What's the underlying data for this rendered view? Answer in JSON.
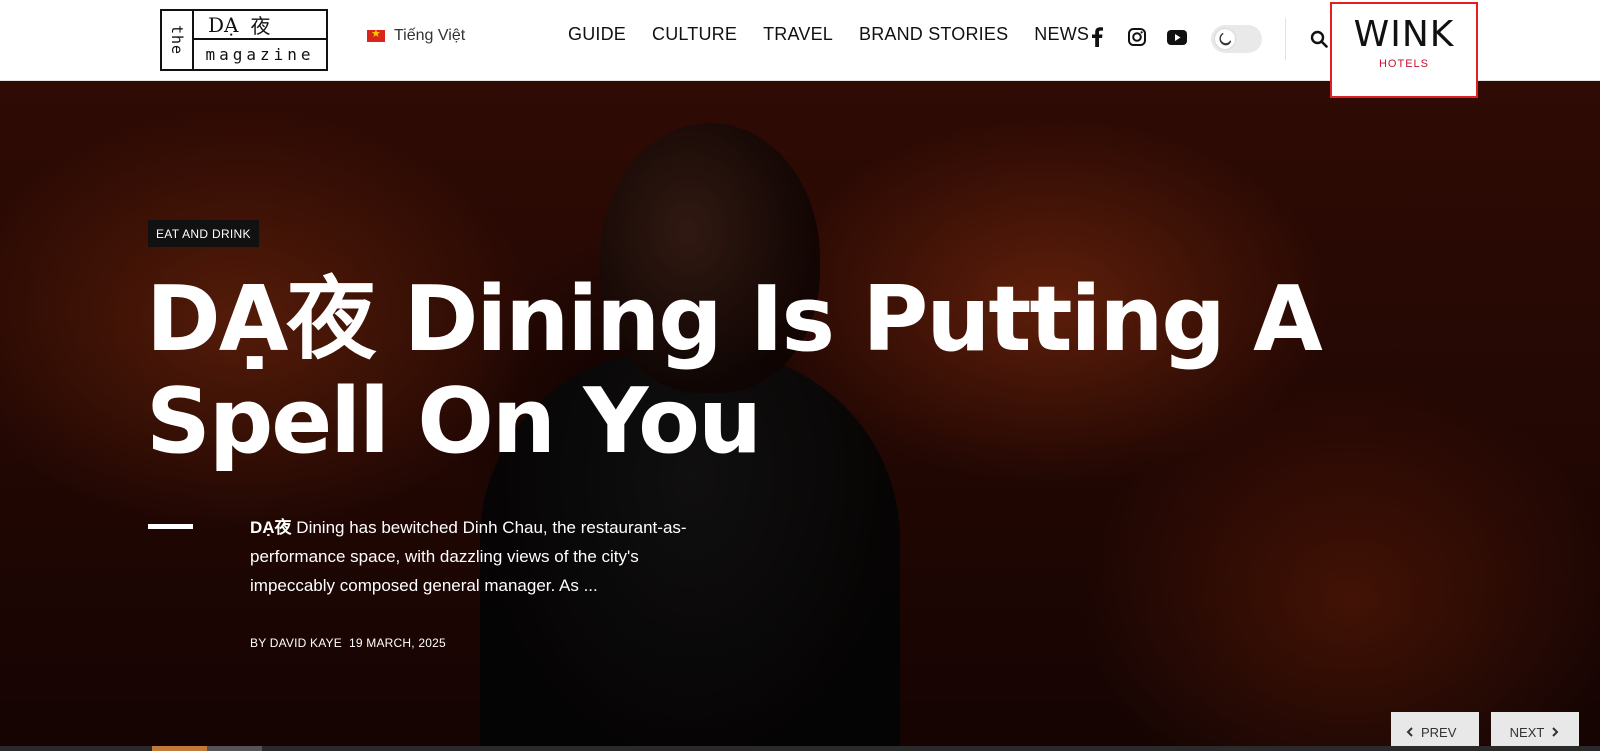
{
  "logo": {
    "the": "the",
    "da": "DẠ",
    "ye": "夜",
    "magazine": "magazine"
  },
  "language": {
    "label": "Tiếng Việt",
    "flag_icon": "vietnam-flag-icon"
  },
  "nav": [
    {
      "label": "GUIDE"
    },
    {
      "label": "CULTURE"
    },
    {
      "label": "TRAVEL"
    },
    {
      "label": "BRAND STORIES"
    },
    {
      "label": "NEWS"
    }
  ],
  "social_icons": [
    "facebook-icon",
    "instagram-icon",
    "youtube-icon"
  ],
  "dark_mode_toggle": {
    "icon": "moon-icon",
    "state": "off"
  },
  "search": {
    "icon": "search-icon"
  },
  "ad": {
    "brand": "WINK",
    "sub": "HOTELS",
    "accent_color": "#c8102e"
  },
  "hero": {
    "tag": "EAT AND DRINK",
    "title": "DẠ夜 Dining Is Putting A Spell On You",
    "excerpt_lead": "DẠ夜",
    "excerpt_rest": " Dining has bewitched Dinh Chau, the restaurant-as-performance space, with dazzling views of the city's impeccably composed general manager. As ...",
    "author": "BY DAVID KAYE",
    "date": "19 MARCH, 2025",
    "prev_label": "PREV",
    "next_label": "NEXT"
  },
  "colors": {
    "hero_bg": "#2a0904",
    "tag_bg": "#111111",
    "ad_border": "#e02020",
    "progress_active": "#c07a3a"
  }
}
